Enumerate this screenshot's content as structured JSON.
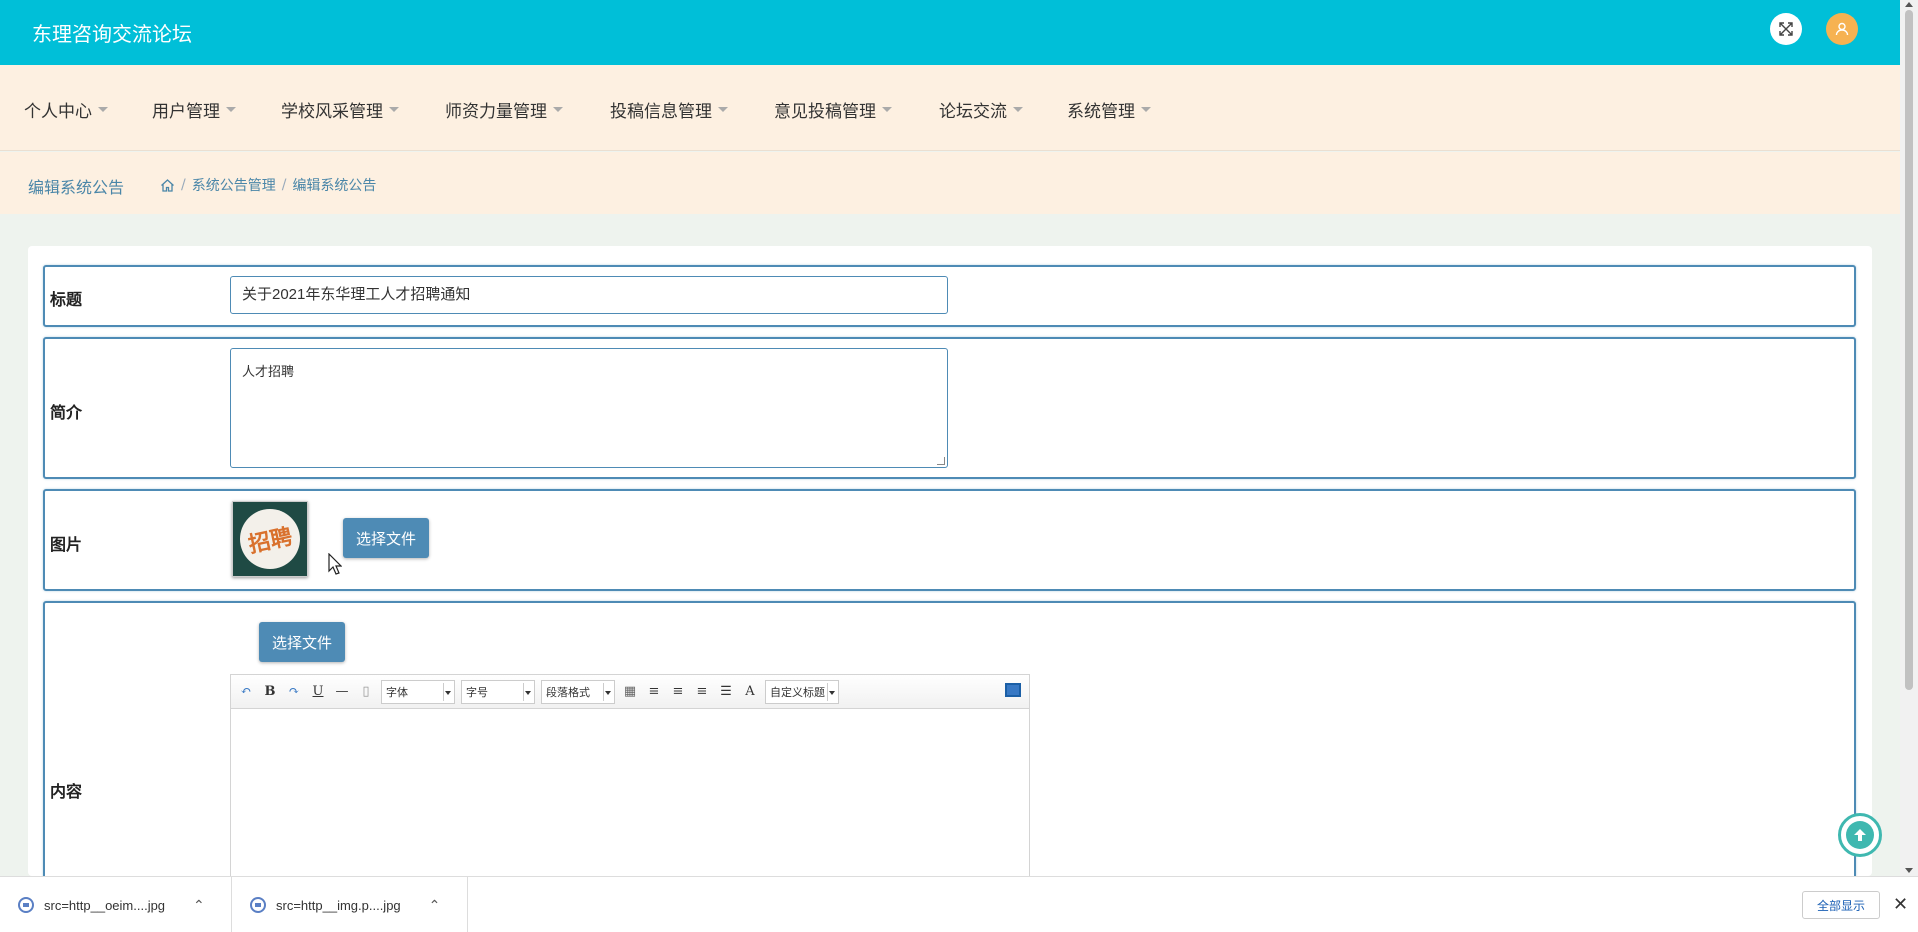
{
  "header": {
    "brand": "东理咨询交流论坛",
    "fullscreen_icon": "expand-icon",
    "user_icon": "user-icon",
    "accent": "#00bfd8"
  },
  "nav": {
    "items": [
      {
        "label": "个人中心"
      },
      {
        "label": "用户管理"
      },
      {
        "label": "学校风采管理"
      },
      {
        "label": "师资力量管理"
      },
      {
        "label": "投稿信息管理"
      },
      {
        "label": "意见投稿管理"
      },
      {
        "label": "论坛交流"
      },
      {
        "label": "系统管理"
      }
    ]
  },
  "breadcrumb": {
    "page_title": "编辑系统公告",
    "home_icon": "home-icon",
    "sep": "/",
    "parent": "系统公告管理",
    "current": "编辑系统公告"
  },
  "form": {
    "title_label": "标题",
    "title_value": "关于2021年东华理工人才招聘通知",
    "summary_label": "简介",
    "summary_value": "人才招聘",
    "image_label": "图片",
    "image_caption": "招聘",
    "choose_file": "选择文件",
    "content_label": "内容",
    "content_choose_file": "选择文件"
  },
  "editor": {
    "toolbar": {
      "bold": "B",
      "underline": "U",
      "font_family": "字体",
      "font_size": "字号",
      "paragraph": "段落格式",
      "font_color": "A",
      "custom_title": "自定义标题"
    }
  },
  "downloads": {
    "files": [
      {
        "name": "src=http__oeim....jpg"
      },
      {
        "name": "src=http__img.p....jpg"
      }
    ],
    "show_all": "全部显示",
    "close": "✕"
  }
}
